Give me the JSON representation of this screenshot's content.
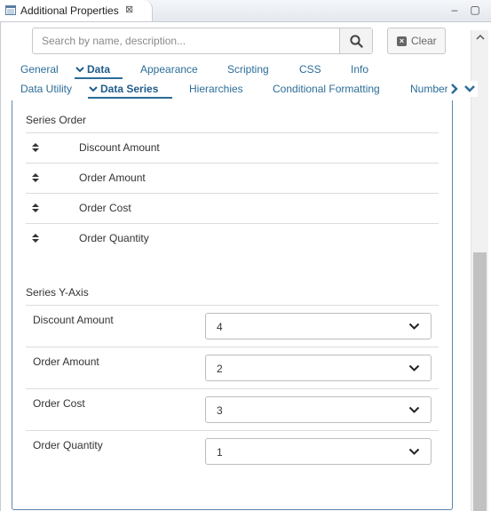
{
  "window": {
    "tab_title": "Additional Properties",
    "tab_close_glyph": "⊠",
    "minimize_glyph": "–",
    "maximize_glyph": "▢"
  },
  "search": {
    "placeholder": "Search by name, description...",
    "value": "",
    "clear_label": "Clear"
  },
  "tabs_row1": [
    {
      "label": "General",
      "active": false
    },
    {
      "label": "Data",
      "active": true
    },
    {
      "label": "Appearance",
      "active": false
    },
    {
      "label": "Scripting",
      "active": false
    },
    {
      "label": "CSS",
      "active": false
    },
    {
      "label": "Info",
      "active": false
    }
  ],
  "tabs_row2": [
    {
      "label": "Data Utility",
      "active": false
    },
    {
      "label": "Data Series",
      "active": true
    },
    {
      "label": "Hierarchies",
      "active": false
    },
    {
      "label": "Conditional Formatting",
      "active": false
    },
    {
      "label": "Number",
      "active": false
    }
  ],
  "series_order": {
    "title": "Series Order",
    "items": [
      "Discount Amount",
      "Order Amount",
      "Order Cost",
      "Order Quantity"
    ]
  },
  "series_y_axis": {
    "title": "Series Y-Axis",
    "rows": [
      {
        "label": "Discount Amount",
        "value": "4"
      },
      {
        "label": "Order Amount",
        "value": "2"
      },
      {
        "label": "Order Cost",
        "value": "3"
      },
      {
        "label": "Order Quantity",
        "value": "1"
      }
    ]
  },
  "colors": {
    "accent": "#2c6d97",
    "panel_border": "#5b86ad",
    "scroll_thumb": "#c1c1c1"
  }
}
